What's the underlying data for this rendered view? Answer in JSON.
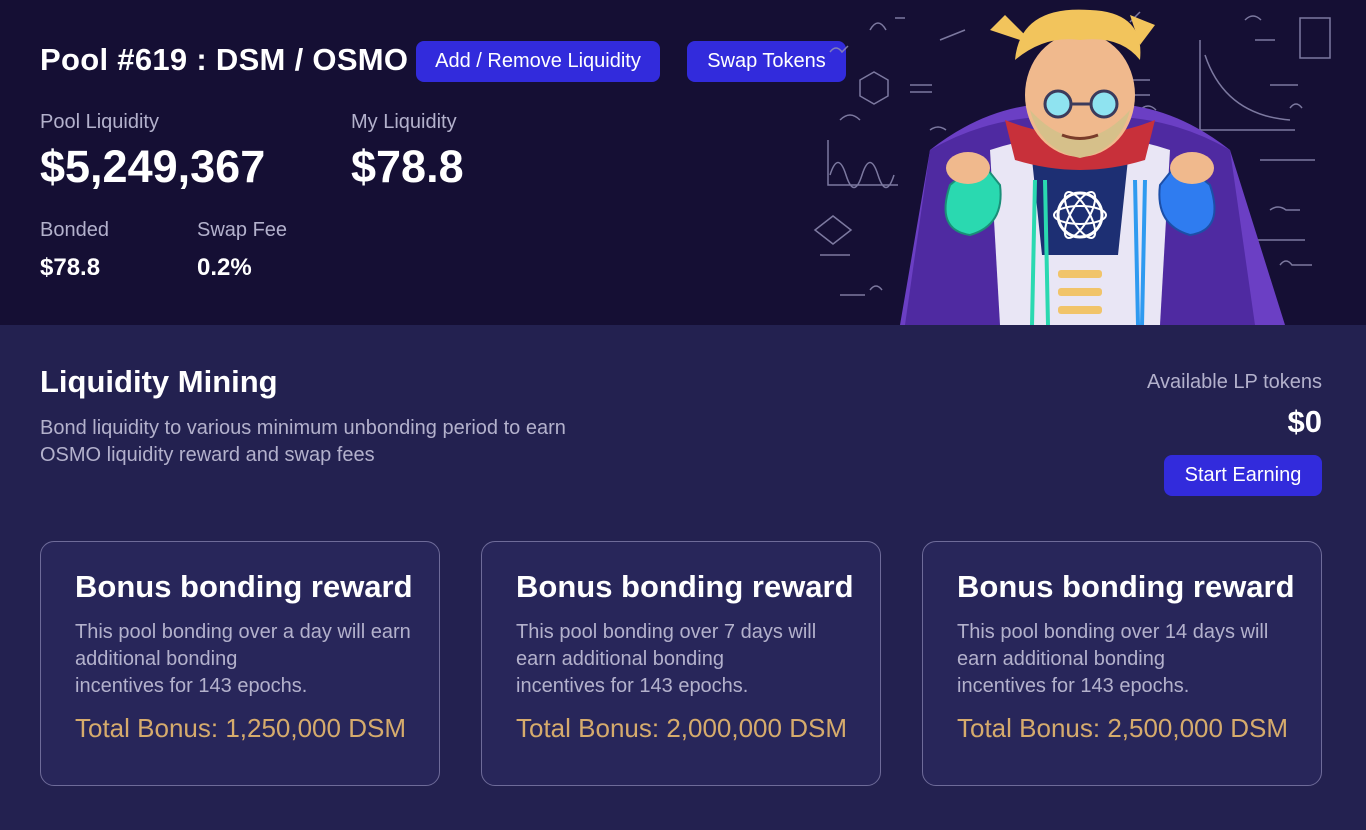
{
  "header": {
    "pool_title": "Pool #619 : DSM / OSMO",
    "add_remove_label": "Add / Remove Liquidity",
    "swap_label": "Swap Tokens"
  },
  "stats": {
    "pool_liquidity_label": "Pool Liquidity",
    "pool_liquidity_value": "$5,249,367",
    "my_liquidity_label": "My Liquidity",
    "my_liquidity_value": "$78.8",
    "bonded_label": "Bonded",
    "bonded_value": "$78.8",
    "swap_fee_label": "Swap Fee",
    "swap_fee_value": "0.2%"
  },
  "hero": {
    "icon": "scientist-mascot-illustration"
  },
  "mining": {
    "title": "Liquidity Mining",
    "desc_line1": "Bond liquidity to various minimum unbonding period to earn",
    "desc_line2": "OSMO liquidity reward and swap fees",
    "available_label": "Available LP tokens",
    "available_value": "$0",
    "start_label": "Start Earning"
  },
  "cards": [
    {
      "title": "Bonus bonding reward",
      "line1": "This pool bonding over a day will earn",
      "line2": "additional bonding",
      "line3": "incentives for 143 epochs.",
      "bonus": "Total Bonus: 1,250,000 DSM"
    },
    {
      "title": "Bonus bonding reward",
      "line1": "This pool bonding over 7 days will",
      "line2": "earn additional bonding",
      "line3": "incentives for 143 epochs.",
      "bonus": "Total Bonus: 2,000,000 DSM"
    },
    {
      "title": "Bonus bonding reward",
      "line1": "This pool bonding over 14 days will",
      "line2": "earn additional bonding",
      "line3": "incentives for 143 epochs.",
      "bonus": "Total Bonus: 2,500,000 DSM"
    }
  ],
  "colors": {
    "header_bg": "#150f34",
    "page_bg": "#232150",
    "button": "#322bdc",
    "bonus_text": "#d6ab6c"
  }
}
